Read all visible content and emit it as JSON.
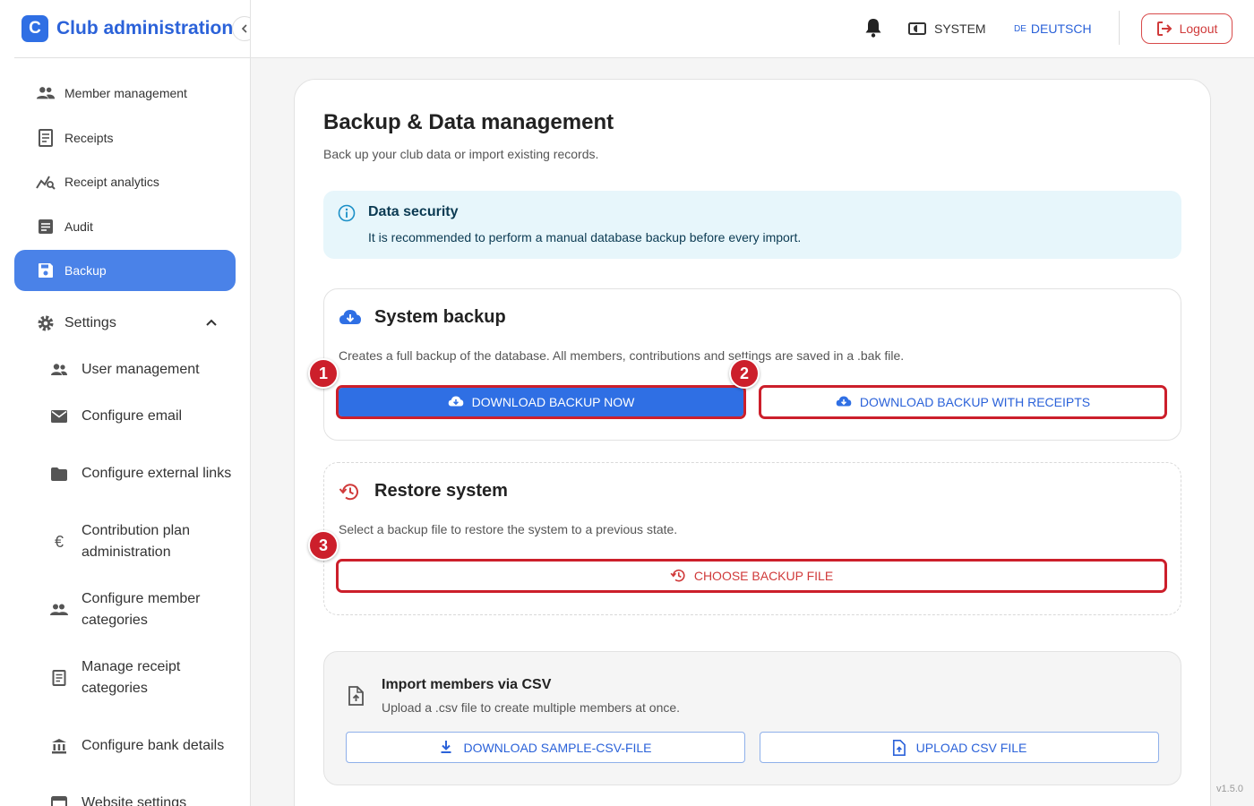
{
  "brand": {
    "logo_letter": "C",
    "title": "Club administration"
  },
  "sidebar": {
    "items": [
      {
        "label": "Member management",
        "icon": "people-icon"
      },
      {
        "label": "Receipts",
        "icon": "receipt-icon"
      },
      {
        "label": "Receipt analytics",
        "icon": "analytics-icon"
      },
      {
        "label": "Audit",
        "icon": "document-icon"
      },
      {
        "label": "Backup",
        "icon": "save-icon",
        "active": true
      }
    ],
    "settings": {
      "label": "Settings",
      "items": [
        {
          "label": "User management",
          "icon": "user-group-icon"
        },
        {
          "label": "Configure email",
          "icon": "email-icon"
        },
        {
          "label": "Configure external links",
          "icon": "folder-icon"
        },
        {
          "label": "Contribution plan administration",
          "icon": "euro-icon"
        },
        {
          "label": "Configure member categories",
          "icon": "people-icon"
        },
        {
          "label": "Manage receipt categories",
          "icon": "receipt-icon"
        },
        {
          "label": "Configure bank details",
          "icon": "bank-icon"
        },
        {
          "label": "Website settings",
          "icon": "window-icon"
        }
      ]
    }
  },
  "topbar": {
    "system_label": "SYSTEM",
    "lang_flag": "DE",
    "lang_label": "DEUTSCH",
    "logout_label": "Logout"
  },
  "page": {
    "title": "Backup & Data management",
    "subtitle": "Back up your club data or import existing records.",
    "info": {
      "title": "Data security",
      "text": "It is recommended to perform a manual database backup before every import."
    },
    "system_backup": {
      "title": "System backup",
      "text": "Creates a full backup of the database. All members, contributions and settings are saved in a .bak file.",
      "download_now": "DOWNLOAD BACKUP NOW",
      "download_with_receipts": "DOWNLOAD BACKUP WITH RECEIPTS"
    },
    "restore": {
      "title": "Restore system",
      "text": "Select a backup file to restore the system to a previous state.",
      "choose_file": "CHOOSE BACKUP FILE"
    },
    "import": {
      "title": "Import members via CSV",
      "text": "Upload a .csv file to create multiple members at once.",
      "download_sample": "DOWNLOAD SAMPLE-CSV-FILE",
      "upload": "UPLOAD CSV FILE"
    }
  },
  "markers": [
    "1",
    "2",
    "3"
  ],
  "version": "v1.5.0",
  "colors": {
    "primary": "#2f6fe4",
    "highlight": "#cc1f2b",
    "danger": "#d03a3a",
    "info_bg": "#e7f6fb"
  }
}
